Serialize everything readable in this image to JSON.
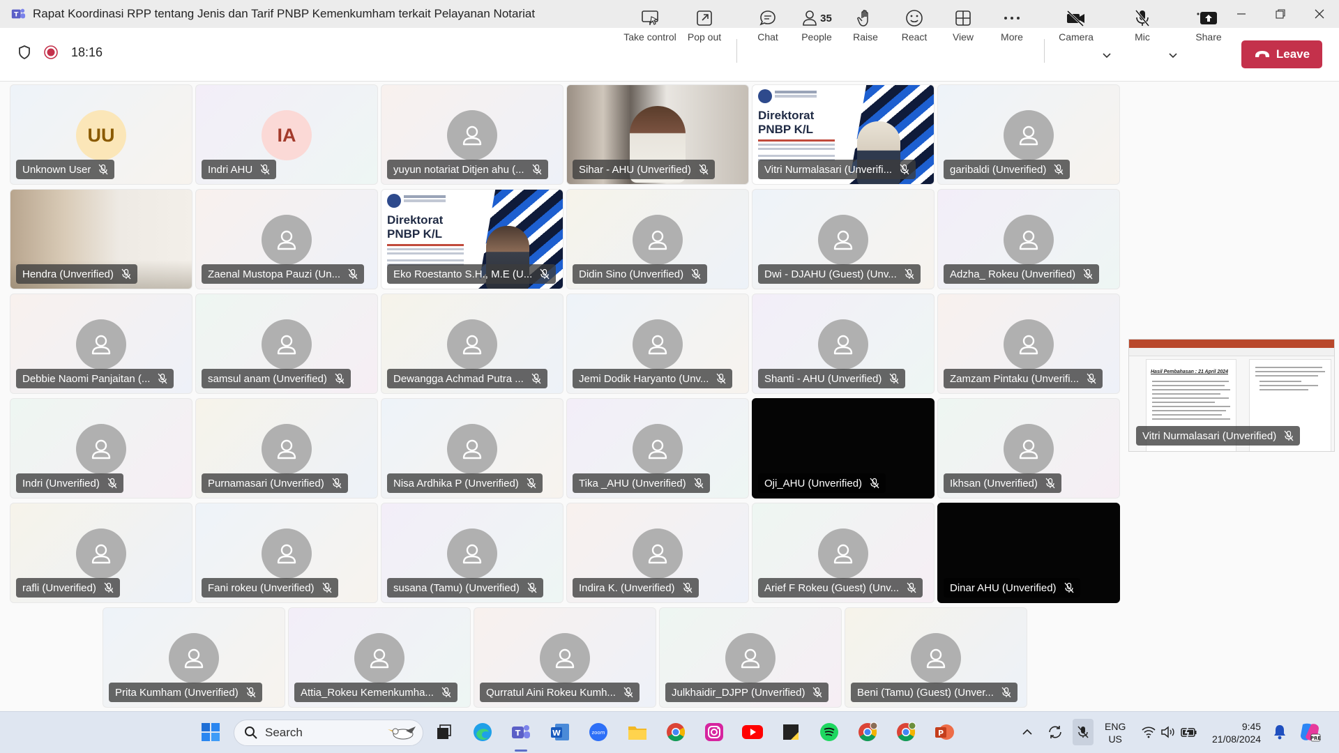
{
  "window": {
    "title": "Rapat Koordinasi RPP tentang Jenis dan Tarif PNBP Kemenkumham terkait Pelayanan Notariat",
    "controls": [
      "more-options",
      "minimize",
      "maximize",
      "close"
    ]
  },
  "toolbar": {
    "timer": "18:16",
    "take_control": "Take control",
    "pop_out": "Pop out",
    "chat": "Chat",
    "people": "People",
    "people_count": "35",
    "raise": "Raise",
    "react": "React",
    "view": "View",
    "more": "More",
    "camera": "Camera",
    "mic": "Mic",
    "share": "Share",
    "leave": "Leave"
  },
  "colors": {
    "leave_red": "#c4314b",
    "record_red": "#c4314b",
    "avatar_grey": "#b0b0b0",
    "teams_purple": "#5b5fc7"
  },
  "participants": [
    {
      "name": "Unknown User",
      "initials": "UU",
      "kind": "initials"
    },
    {
      "name": "Indri AHU",
      "initials": "IA",
      "kind": "initials"
    },
    {
      "name": "yuyun notariat Ditjen ahu (...",
      "kind": "avatar"
    },
    {
      "name": "Sihar - AHU (Unverified)",
      "kind": "video"
    },
    {
      "name": "Vitri Nurmalasari (Unverifi...",
      "kind": "slide"
    },
    {
      "name": "garibaldi (Unverified)",
      "kind": "avatar"
    },
    {
      "name": "Hendra (Unverified)",
      "kind": "video"
    },
    {
      "name": "Zaenal Mustopa Pauzi (Un...",
      "kind": "avatar"
    },
    {
      "name": "Eko Roestanto S.H., M.E (U...",
      "kind": "slide"
    },
    {
      "name": "Didin Sino (Unverified)",
      "kind": "avatar"
    },
    {
      "name": "Dwi - DJAHU (Guest) (Unv...",
      "kind": "avatar"
    },
    {
      "name": "Adzha_ Rokeu (Unverified)",
      "kind": "avatar"
    },
    {
      "name": "Debbie Naomi Panjaitan (...",
      "kind": "avatar"
    },
    {
      "name": "samsul anam (Unverified)",
      "kind": "avatar"
    },
    {
      "name": "Dewangga Achmad Putra ...",
      "kind": "avatar"
    },
    {
      "name": "Jemi Dodik Haryanto (Unv...",
      "kind": "avatar"
    },
    {
      "name": "Shanti - AHU (Unverified)",
      "kind": "avatar"
    },
    {
      "name": "Zamzam Pintaku (Unverifi...",
      "kind": "avatar"
    },
    {
      "name": "Indri (Unverified)",
      "kind": "avatar"
    },
    {
      "name": "Purnamasari (Unverified)",
      "kind": "avatar"
    },
    {
      "name": "Nisa Ardhika P (Unverified)",
      "kind": "avatar"
    },
    {
      "name": "Tika _AHU (Unverified)",
      "kind": "avatar"
    },
    {
      "name": "Oji_AHU (Unverified)",
      "kind": "dark"
    },
    {
      "name": "Ikhsan (Unverified)",
      "kind": "avatar"
    },
    {
      "name": "rafli (Unverified)",
      "kind": "avatar"
    },
    {
      "name": "Fani rokeu (Unverified)",
      "kind": "avatar"
    },
    {
      "name": "susana (Tamu) (Unverified)",
      "kind": "avatar"
    },
    {
      "name": "Indira K. (Unverified)",
      "kind": "avatar"
    },
    {
      "name": "Arief F Rokeu (Guest) (Unv...",
      "kind": "avatar"
    },
    {
      "name": "Dinar AHU (Unverified)",
      "kind": "dark"
    },
    {
      "name": "Prita Kumham (Unverified)",
      "kind": "avatar"
    },
    {
      "name": "Attia_Rokeu Kemenkumha...",
      "kind": "avatar"
    },
    {
      "name": "Qurratul Aini Rokeu Kumh...",
      "kind": "avatar"
    },
    {
      "name": "Julkhaidir_DJPP (Unverified)",
      "kind": "avatar"
    },
    {
      "name": "Beni (Tamu) (Guest) (Unver...",
      "kind": "avatar"
    }
  ],
  "slide": {
    "title_line1": "Direktorat",
    "title_line2": "PNBP K/L"
  },
  "shared_screen": {
    "presenter": "Vitri Nurmalasari (Unverified)",
    "doc_heading": "Hasil Pembahasan : 21 April 2024"
  },
  "taskbar": {
    "search_placeholder": "Search",
    "language_line1": "ENG",
    "language_line2": "US",
    "time": "9:45",
    "date": "21/08/2024",
    "apps": [
      "start",
      "search",
      "task-view",
      "edge",
      "teams",
      "word",
      "zoom",
      "file-explorer",
      "chrome",
      "instagram",
      "youtube",
      "sticky-notes",
      "spotify",
      "chrome-profile-1",
      "chrome-profile-2",
      "powerpoint"
    ]
  }
}
